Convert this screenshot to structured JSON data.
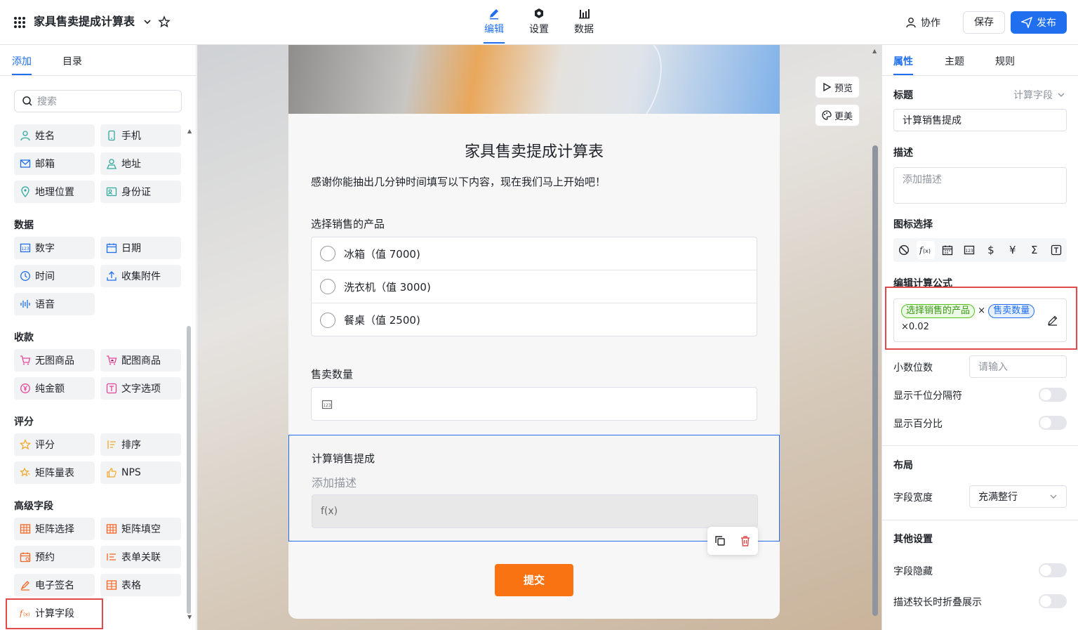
{
  "header": {
    "app_title": "家具售卖提成计算表",
    "tabs": [
      {
        "label": "编辑",
        "icon": "pencil-icon",
        "active": true
      },
      {
        "label": "设置",
        "icon": "settings-icon",
        "active": false
      },
      {
        "label": "数据",
        "icon": "bar-chart-icon",
        "active": false
      }
    ],
    "collab_label": "协作",
    "save_label": "保存",
    "publish_label": "发布"
  },
  "left_panel": {
    "tabs": [
      {
        "label": "添加",
        "active": true
      },
      {
        "label": "目录",
        "active": false
      }
    ],
    "search_placeholder": "搜索",
    "contact_items": [
      "姓名",
      "手机",
      "邮箱",
      "地址",
      "地理位置",
      "身份证"
    ],
    "groups": [
      {
        "title": "数据",
        "items": [
          "数字",
          "日期",
          "时间",
          "收集附件",
          "语音"
        ]
      },
      {
        "title": "收款",
        "items": [
          "无图商品",
          "配图商品",
          "纯金额",
          "文字选项"
        ]
      },
      {
        "title": "评分",
        "items": [
          "评分",
          "排序",
          "矩阵量表",
          "NPS"
        ]
      },
      {
        "title": "高级字段",
        "items": [
          "矩阵选择",
          "矩阵填空",
          "预约",
          "表单关联",
          "电子签名",
          "表格",
          "计算字段"
        ]
      }
    ]
  },
  "canvas": {
    "side_buttons": {
      "preview": "预览",
      "beautify": "更美"
    },
    "form_title": "家具售卖提成计算表",
    "form_desc": "感谢你能抽出几分钟时间填写以下内容，现在我们马上开始吧！",
    "q1": {
      "label": "选择销售的产品",
      "options": [
        "冰箱（值 7000)",
        "洗衣机（值 3000)",
        "餐桌（值 2500)"
      ]
    },
    "q2": {
      "label": "售卖数量"
    },
    "q3": {
      "label": "计算销售提成",
      "desc_placeholder": "添加描述",
      "fx": "f(x)"
    },
    "submit_label": "提交"
  },
  "right_panel": {
    "tabs": [
      {
        "label": "属性",
        "active": true
      },
      {
        "label": "主题",
        "active": false
      },
      {
        "label": "规则",
        "active": false
      }
    ],
    "title_label": "标题",
    "field_type": "计算字段",
    "title_value": "计算销售提成",
    "desc_label": "描述",
    "desc_placeholder": "添加描述",
    "icon_label": "图标选择",
    "icons": [
      "ban-icon",
      "fx-icon",
      "calendar-icon",
      "number-icon",
      "dollar-icon",
      "yen-icon",
      "sigma-icon",
      "text-icon"
    ],
    "formula_label": "编辑计算公式",
    "formula": {
      "field_a": "选择销售的产品",
      "op": "×",
      "field_b": "售卖数量",
      "tail": "×0.02"
    },
    "decimal_label": "小数位数",
    "decimal_placeholder": "请输入",
    "thousand_sep_label": "显示千位分隔符",
    "percent_label": "显示百分比",
    "layout_label": "布局",
    "width_label": "字段宽度",
    "width_value": "充满整行",
    "other_label": "其他设置",
    "hidden_label": "字段隐藏",
    "collapse_label": "描述较长时折叠展示"
  }
}
